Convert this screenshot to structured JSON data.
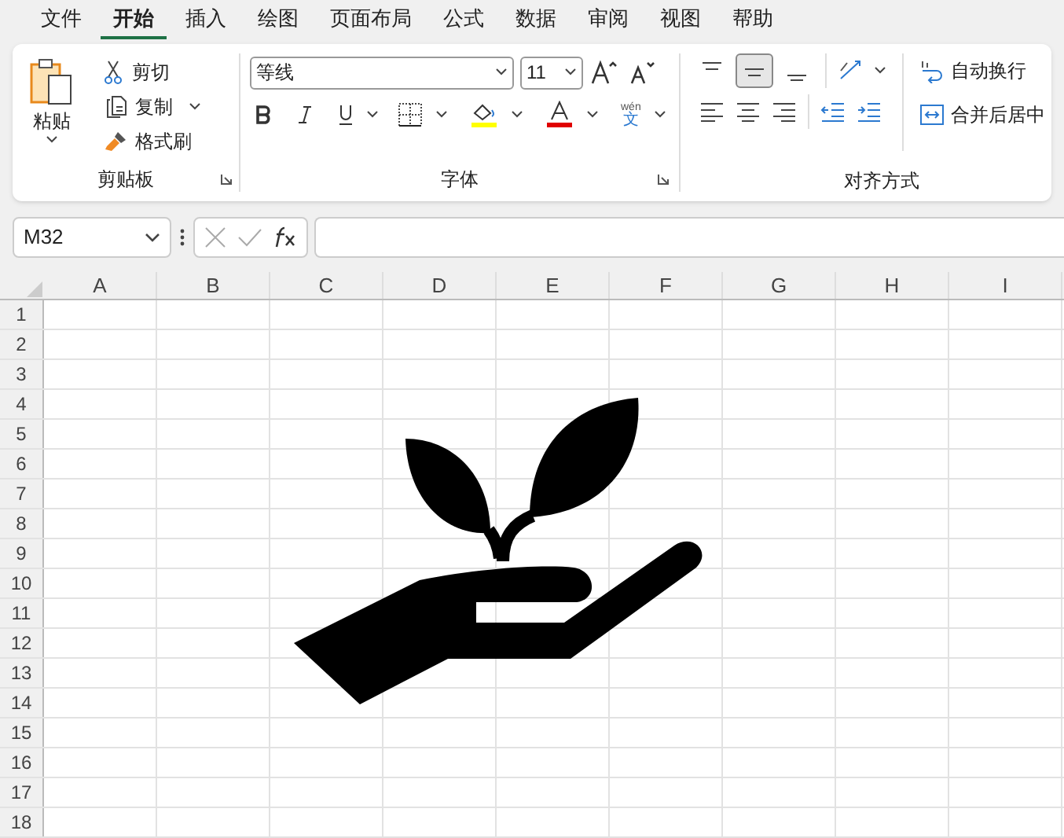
{
  "menu_tabs": [
    {
      "label": "文件",
      "selected": false
    },
    {
      "label": "开始",
      "selected": true
    },
    {
      "label": "插入",
      "selected": false
    },
    {
      "label": "绘图",
      "selected": false
    },
    {
      "label": "页面布局",
      "selected": false
    },
    {
      "label": "公式",
      "selected": false
    },
    {
      "label": "数据",
      "selected": false
    },
    {
      "label": "审阅",
      "selected": false
    },
    {
      "label": "视图",
      "selected": false
    },
    {
      "label": "帮助",
      "selected": false
    }
  ],
  "clipboard": {
    "paste": "粘贴",
    "cut": "剪切",
    "copy": "复制",
    "format_painter": "格式刷",
    "group_label": "剪贴板"
  },
  "font": {
    "name": "等线",
    "size": "11",
    "phonetic": "wén",
    "phonetic_char": "文",
    "group_label": "字体"
  },
  "alignment": {
    "vertical": [
      {
        "selected": false
      },
      {
        "selected": true
      },
      {
        "selected": false
      }
    ],
    "wrap_text": "自动换行",
    "merge_center": "合并后居中",
    "group_label": "对齐方式"
  },
  "name_box": "M32",
  "columns": [
    "A",
    "B",
    "C",
    "D",
    "E",
    "F",
    "G",
    "H",
    "I"
  ],
  "rows": [
    "1",
    "2",
    "3",
    "4",
    "5",
    "6",
    "7",
    "8",
    "9",
    "10",
    "11",
    "12",
    "13",
    "14",
    "15",
    "16",
    "17",
    "18"
  ]
}
